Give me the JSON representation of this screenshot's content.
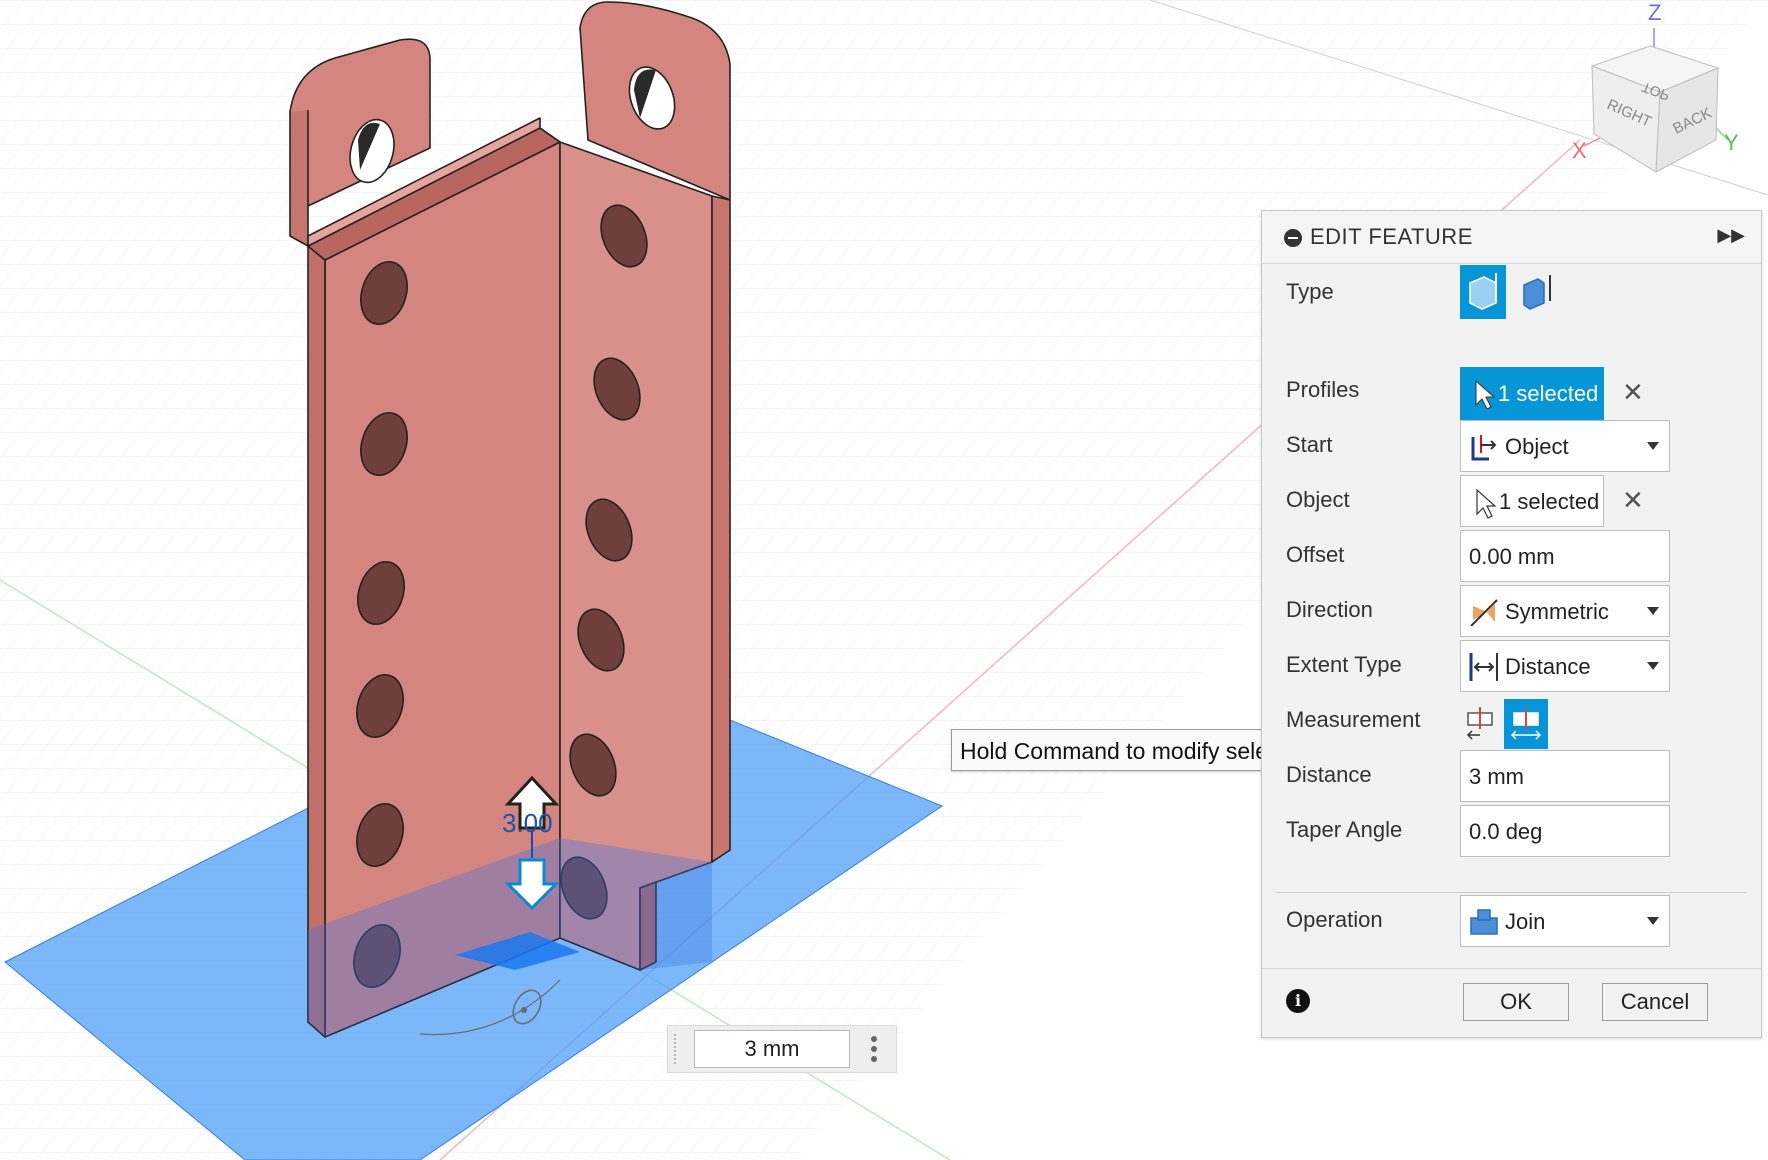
{
  "viewcube": {
    "axis_z": "Z",
    "axis_x": "X",
    "axis_y": "Y",
    "face_top": "TOP",
    "face_right": "RIGHT",
    "face_back": "BACK"
  },
  "manipulator": {
    "value_text": "3.00"
  },
  "tooltip": {
    "text": "Hold Command to modify selection"
  },
  "distance_input": {
    "value": "3 mm"
  },
  "panel": {
    "title": "EDIT FEATURE",
    "type_label": "Type",
    "profiles_label": "Profiles",
    "profiles_value": "1 selected",
    "start_label": "Start",
    "start_value": "Object",
    "object_label": "Object",
    "object_value": "1 selected",
    "offset_label": "Offset",
    "offset_value": "0.00 mm",
    "direction_label": "Direction",
    "direction_value": "Symmetric",
    "extent_type_label": "Extent Type",
    "extent_type_value": "Distance",
    "measurement_label": "Measurement",
    "distance_label": "Distance",
    "distance_value": "3 mm",
    "taper_label": "Taper Angle",
    "taper_value": "0.0 deg",
    "operation_label": "Operation",
    "operation_value": "Join",
    "ok_label": "OK",
    "cancel_label": "Cancel"
  },
  "colors": {
    "accent": "#0696d7",
    "body": "#d98c85",
    "profile_plane": "#3d95f5"
  }
}
